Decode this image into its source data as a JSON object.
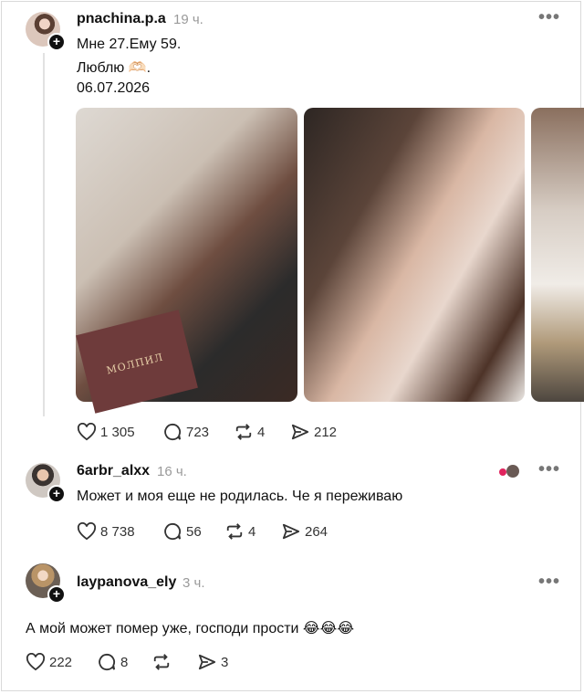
{
  "post": {
    "username": "pnachina.p.a",
    "time": "19 ч.",
    "lines": [
      "Мне 27.Ему 59.",
      "Люблю 🫶🏻.",
      "06.07.2026"
    ],
    "book_text": "МОЛПИЛ",
    "stats": {
      "likes": "1 305",
      "replies": "723",
      "reposts": "4",
      "shares": "212"
    }
  },
  "comments": [
    {
      "username": "6arbr_alxx",
      "time": "16 ч.",
      "text": "Может и моя еще не родилась. Че я переживаю",
      "stats": {
        "likes": "8 738",
        "replies": "56",
        "reposts": "4",
        "shares": "264"
      }
    },
    {
      "username": "laypanova_ely",
      "time": "3 ч.",
      "text": "А мой может помер уже, господи прости 😂😂😂",
      "stats": {
        "likes": "222",
        "replies": "8",
        "reposts": "",
        "shares": "3"
      }
    }
  ],
  "icons": [
    "heart-icon",
    "reply-icon",
    "repost-icon",
    "share-icon",
    "more-icon",
    "follow-plus-icon"
  ]
}
